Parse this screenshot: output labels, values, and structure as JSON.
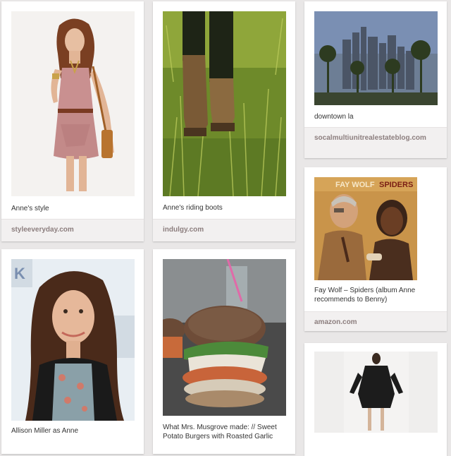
{
  "pins": [
    {
      "description": "Anne's style",
      "source": "styleeveryday.com"
    },
    {
      "description": "Anne's riding boots",
      "source": "indulgy.com"
    },
    {
      "description": "downtown la",
      "source": "socalmultiunitrealestateblog.com"
    },
    {
      "description": "Fay Wolf – Spiders (album Anne recommends to Benny)",
      "source": "amazon.com",
      "album_text": {
        "artist": "FAY WOLF",
        "title": "SPIDERS"
      }
    },
    {
      "description": "Allison Miller as Anne"
    },
    {
      "description": "What Mrs. Musgrove made: // Sweet Potato Burgers with Roasted Garlic"
    },
    {
      "description": ""
    }
  ]
}
